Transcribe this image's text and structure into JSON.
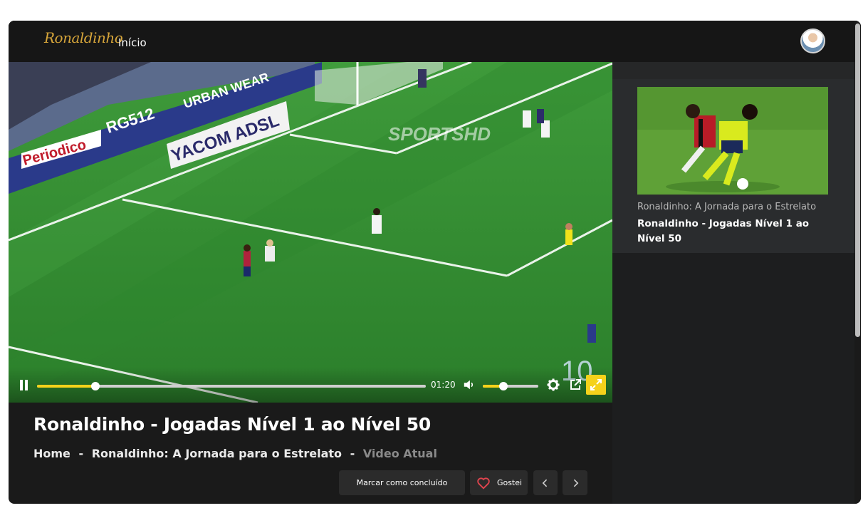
{
  "header": {
    "logo_text": "Ronaldinho",
    "nav_home": "Início"
  },
  "video": {
    "watermark": "SPORTSHD",
    "overlay_number": "10",
    "board_texts": [
      "YACOM ADSL",
      "URBAN WEAR",
      "RG512",
      "Periodico"
    ],
    "time": "01:20",
    "progress": 0.15,
    "volume": 0.37
  },
  "main": {
    "title": "Ronaldinho - Jogadas Nível 1 ao Nível 50",
    "breadcrumb": {
      "home": "Home",
      "sep": "-",
      "module": "Ronaldinho: A Jornada para o Estrelato",
      "current": "Video Atual"
    },
    "actions": {
      "complete_label": "Marcar como concluído",
      "like_label": "Gostei"
    }
  },
  "sidebar": {
    "items": [
      {
        "module": "Ronaldinho: A Jornada para o Estrelato",
        "title": "Ronaldinho - Jogadas Nível 1 ao Nível 50"
      }
    ]
  },
  "colors": {
    "accent": "#f5d21b",
    "logo": "#d6a53a",
    "background": "#1a1a1a",
    "heart": "#e0444e"
  },
  "icons": [
    "pause-icon",
    "volume-icon",
    "gear-icon",
    "popout-icon",
    "fullscreen-icon",
    "heart-icon",
    "chevron-left-icon",
    "chevron-right-icon"
  ]
}
